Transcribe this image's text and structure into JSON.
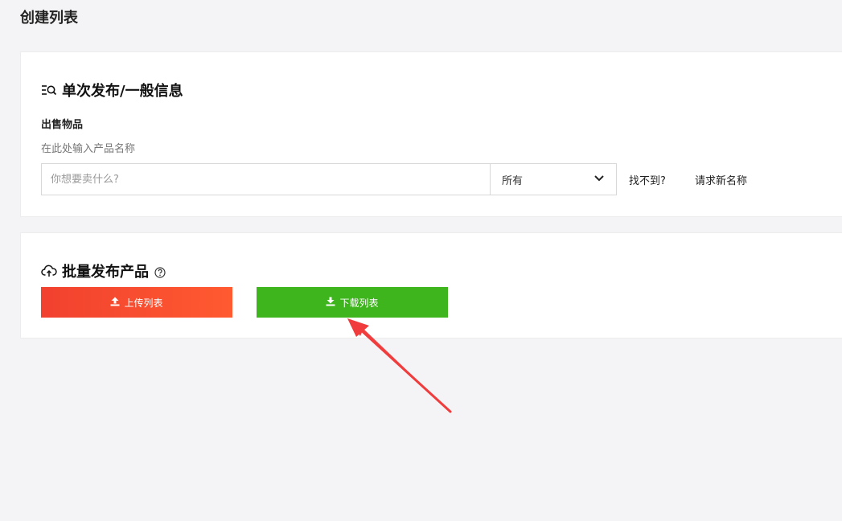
{
  "page": {
    "title": "创建列表"
  },
  "single": {
    "section_title": "单次发布/一般信息",
    "section_icon": "list-search-icon",
    "field_label": "出售物品",
    "field_hint": "在此处输入产品名称",
    "search": {
      "placeholder": "你想要卖什么?",
      "value": ""
    },
    "category": {
      "selected": "所有",
      "icon": "chevron-down-icon"
    },
    "not_found_link": "找不到?",
    "request_name_link": "请求新名称"
  },
  "bulk": {
    "section_title": "批量发布产品",
    "section_icon": "cloud-upload-icon",
    "help_icon": "question-circle-icon",
    "upload_button": "上传列表",
    "download_button": "下载列表",
    "upload_color": "#f5472f",
    "download_color": "#3eb51c"
  },
  "annotation": {
    "arrow_color": "#f03c3c",
    "icon": "red-arrow-annotation"
  }
}
